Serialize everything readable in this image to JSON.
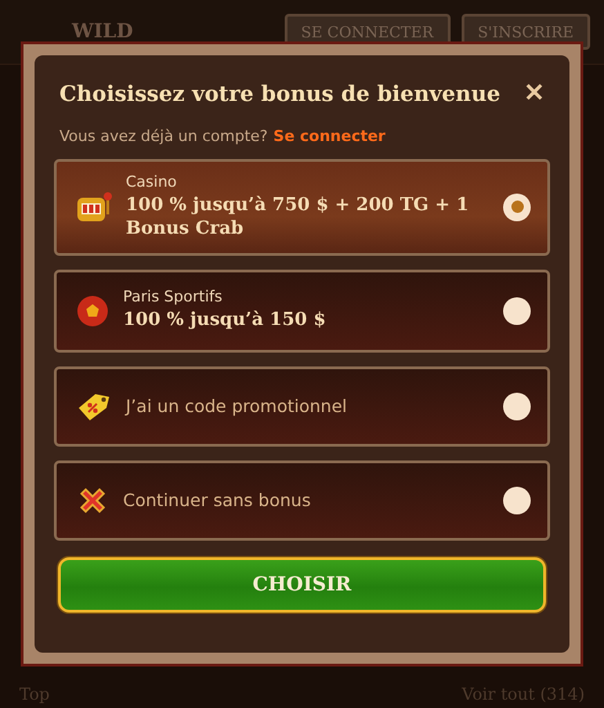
{
  "header": {
    "logo": "WILD",
    "buttons": [
      "SE CONNECTER",
      "S'INSCRIRE"
    ]
  },
  "modal": {
    "title": "Choisissez votre bonus de bienvenue",
    "close": "✕",
    "account_prompt": "Vous avez déjà un compte?",
    "login_link": "Se connecter",
    "options": [
      {
        "kind": "offer",
        "label": "Casino",
        "headline": "100 % jusqu’à 750 $ + 200 TG + 1 Bonus Crab",
        "selected": true
      },
      {
        "kind": "offer",
        "label": "Paris Sportifs",
        "headline": "100 % jusqu’à 150 $",
        "selected": false
      },
      {
        "kind": "simple",
        "label": "J’ai un code promotionnel",
        "selected": false
      },
      {
        "kind": "simple",
        "label": "Continuer sans bonus",
        "selected": false
      }
    ],
    "submit": "CHOISIR"
  },
  "footer": {
    "section_title": "Top",
    "see_all": "Voir tout (314)"
  }
}
